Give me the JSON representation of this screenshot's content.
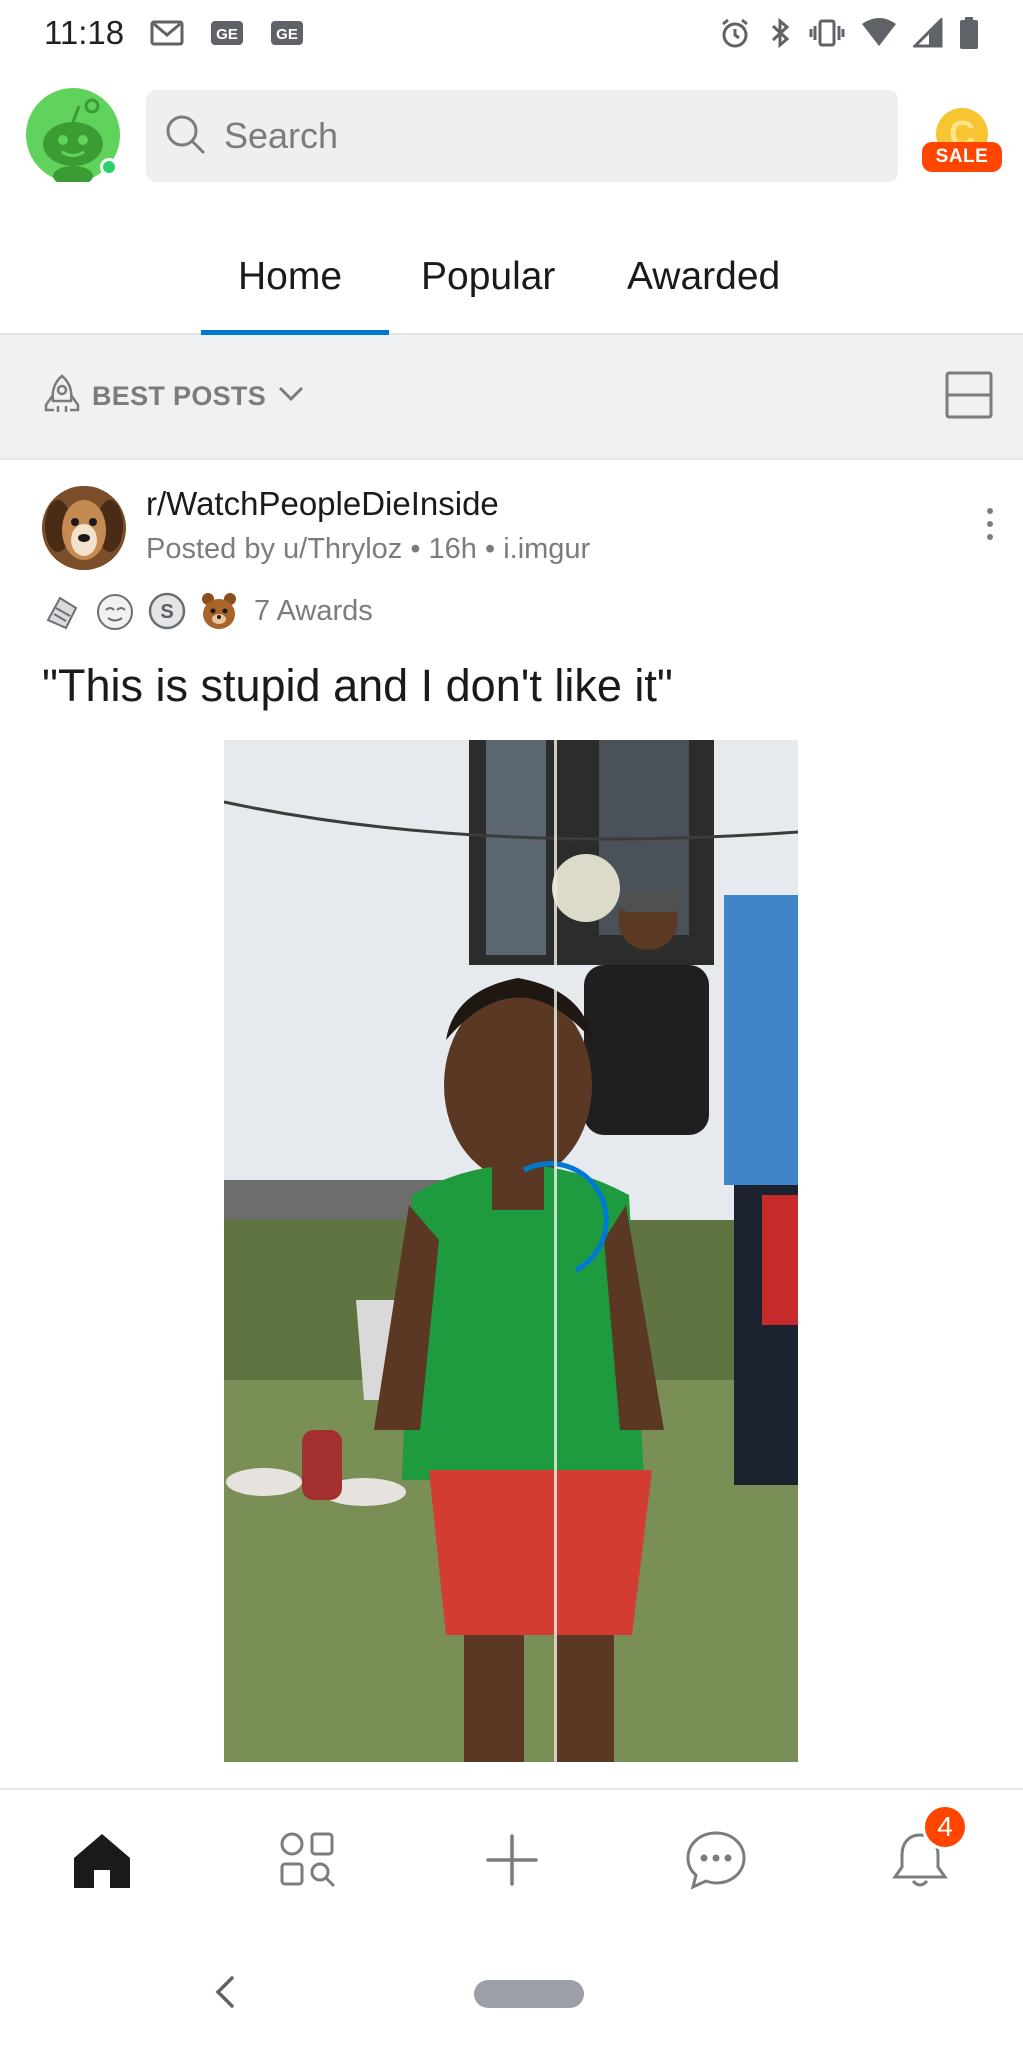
{
  "status_bar": {
    "time": "11:18",
    "left_icons": [
      "gmail-icon",
      "ge-icon",
      "ge-icon"
    ],
    "right_icons": [
      "alarm-icon",
      "bluetooth-icon",
      "vibrate-icon",
      "wifi-icon",
      "signal-icon",
      "battery-icon"
    ]
  },
  "header": {
    "search_placeholder": "Search",
    "coin_letter": "C",
    "sale_label": "SALE"
  },
  "tabs": [
    {
      "label": "Home",
      "active": true
    },
    {
      "label": "Popular",
      "active": false
    },
    {
      "label": "Awarded",
      "active": false
    }
  ],
  "sort": {
    "label": "BEST POSTS"
  },
  "post": {
    "subreddit": "r/WatchPeopleDieInside",
    "meta": "Posted by u/Thryloz • 16h • i.imgur",
    "awards_label": "7 Awards",
    "title": "\"This is stupid and I don't like it\""
  },
  "bottom_nav": {
    "items": [
      "home-icon",
      "discover-icon",
      "create-icon",
      "chat-icon",
      "inbox-icon"
    ],
    "notification_count": "4"
  },
  "colors": {
    "accent": "#0079d3",
    "brand_orange": "#ff4500",
    "text_primary": "#1a1a1b",
    "text_secondary": "#7c7c7c"
  }
}
